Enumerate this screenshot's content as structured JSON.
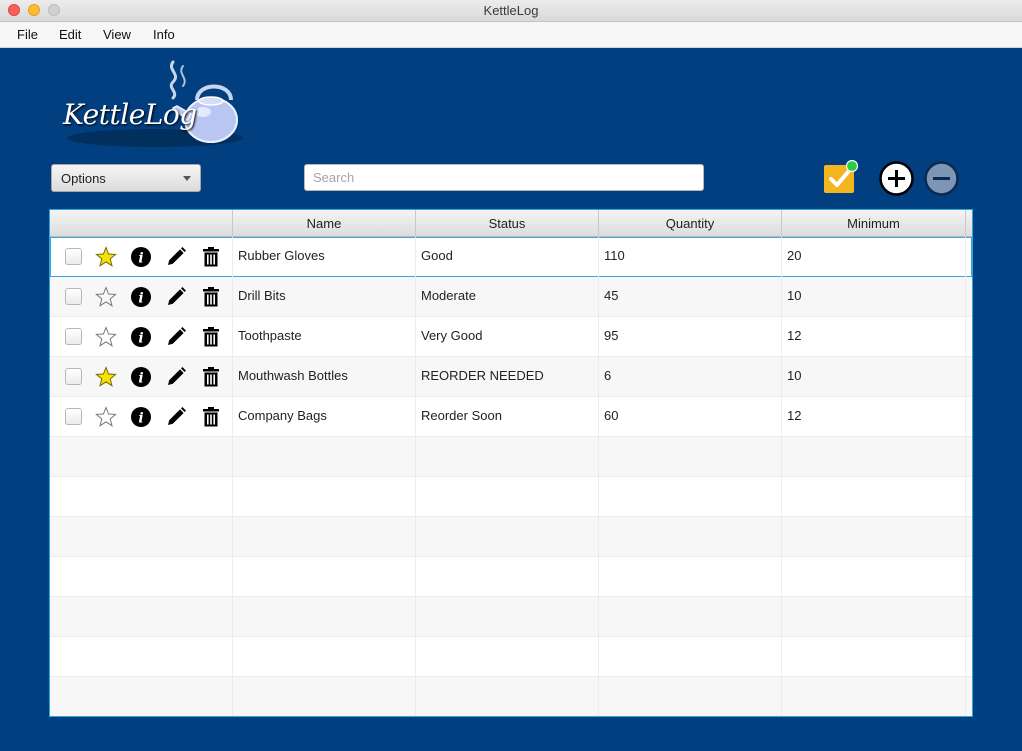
{
  "window": {
    "title": "KettleLog"
  },
  "menu": [
    "File",
    "Edit",
    "View",
    "Info"
  ],
  "logo": {
    "text": "KettleLog"
  },
  "toolbar": {
    "options_label": "Options",
    "search_placeholder": "Search",
    "notify_icon": "checkbox-notification-icon",
    "add_icon": "plus-circle-icon",
    "remove_icon": "minus-circle-icon"
  },
  "table": {
    "columns": [
      "",
      "Name",
      "Status",
      "Quantity",
      "Minimum"
    ],
    "rows": [
      {
        "starred": true,
        "name": "Rubber Gloves",
        "status": "Good",
        "quantity": "110",
        "minimum": "20"
      },
      {
        "starred": false,
        "name": "Drill Bits",
        "status": "Moderate",
        "quantity": "45",
        "minimum": "10"
      },
      {
        "starred": false,
        "name": "Toothpaste",
        "status": "Very Good",
        "quantity": "95",
        "minimum": "12"
      },
      {
        "starred": true,
        "name": "Mouthwash Bottles",
        "status": "REORDER NEEDED",
        "quantity": "6",
        "minimum": "10"
      },
      {
        "starred": false,
        "name": "Company Bags",
        "status": "Reorder Soon",
        "quantity": "60",
        "minimum": "12"
      }
    ],
    "selected_row": 0,
    "row_icons": [
      "checkbox",
      "star-icon",
      "info-icon",
      "pencil-edit-icon",
      "trash-icon"
    ]
  },
  "colors": {
    "background": "#023f80",
    "table_border": "#2aa7e0",
    "star_filled": "#f4e10a",
    "notify_badge": "#f3b61f",
    "notify_dot": "#2ecc40"
  }
}
